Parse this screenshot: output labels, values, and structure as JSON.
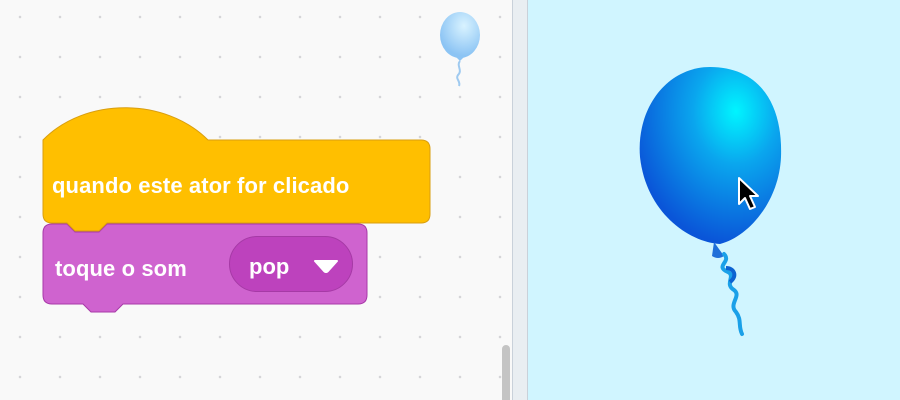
{
  "workspace": {
    "script": {
      "event_block": {
        "label": "quando este ator for clicado",
        "color": "#ffbf00"
      },
      "sound_block": {
        "label": "toque o som",
        "sound_value": "pop",
        "color": "#cf63cf"
      }
    },
    "sprite_thumbnail": {
      "icon": "balloon-icon"
    }
  },
  "stage": {
    "background_color": "#d0f5ff",
    "sprite": {
      "icon": "balloon-icon",
      "color": "#0a86e8"
    },
    "cursor": {
      "icon": "arrow-cursor-icon"
    }
  }
}
